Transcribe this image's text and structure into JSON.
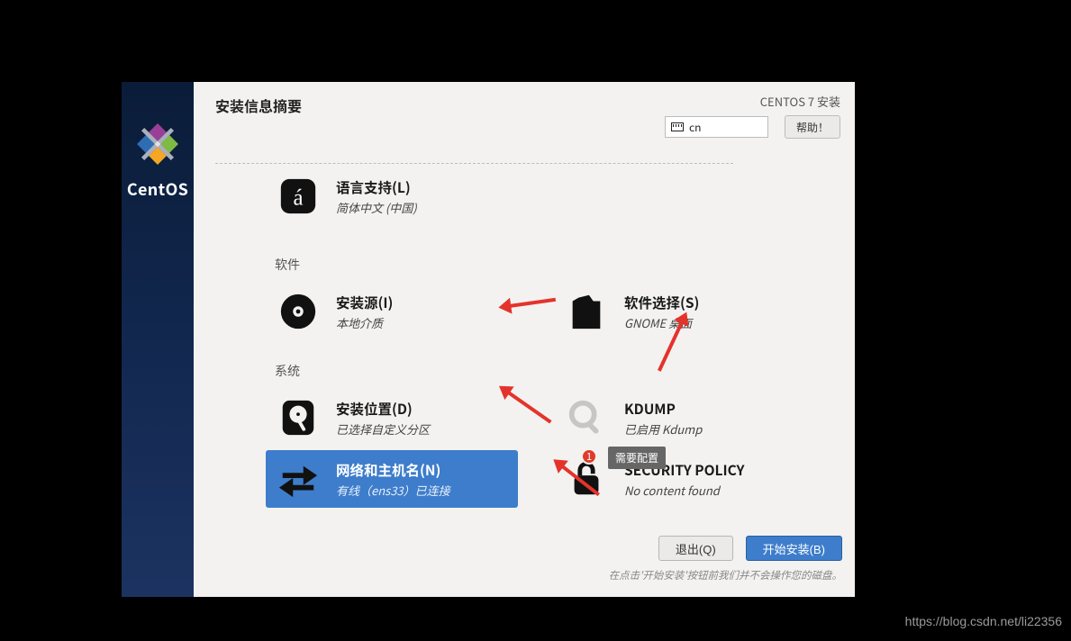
{
  "header": {
    "title": "安装信息摘要",
    "subtitle": "CENTOS 7 安装",
    "keyboard_layout": "cn",
    "help_label": "帮助！"
  },
  "brand": {
    "name": "CentOS"
  },
  "categories": {
    "language": {
      "spoke_language_support": {
        "title": "语言支持(L)",
        "subtitle": "简体中文 (中国)"
      }
    },
    "software": {
      "label": "软件",
      "spoke_source": {
        "title": "安装源(I)",
        "subtitle": "本地介质"
      },
      "spoke_selection": {
        "title": "软件选择(S)",
        "subtitle": "GNOME 桌面"
      }
    },
    "system": {
      "label": "系统",
      "spoke_destination": {
        "title": "安装位置(D)",
        "subtitle": "已选择自定义分区"
      },
      "spoke_kdump": {
        "title": "KDUMP",
        "subtitle": "已启用 Kdump"
      },
      "spoke_network": {
        "title": "网络和主机名(N)",
        "subtitle": "有线（ens33）已连接"
      },
      "spoke_security": {
        "title": "SECURITY POLICY",
        "subtitle": "No content found",
        "tooltip": "需要配置",
        "warn_badge": "1"
      }
    }
  },
  "footer": {
    "quit_label": "退出(Q)",
    "begin_label": "开始安装(B)",
    "hint": "在点击'开始安装'按钮前我们并不会操作您的磁盘。"
  },
  "watermark": "https://blog.csdn.net/li22356"
}
